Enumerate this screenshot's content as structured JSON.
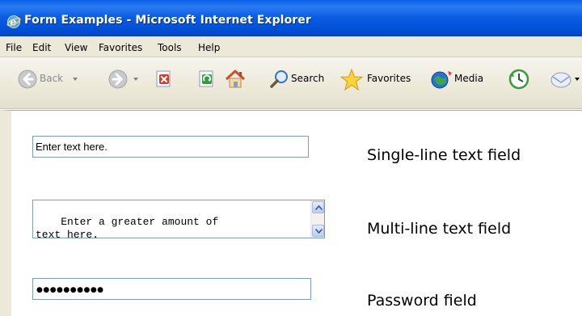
{
  "window": {
    "title": "Form Examples - Microsoft Internet Explorer",
    "app_icon": "ie-icon"
  },
  "menubar": {
    "items": [
      "File",
      "Edit",
      "View",
      "Favorites",
      "Tools",
      "Help"
    ]
  },
  "toolbar": {
    "back_label": "Back",
    "search_label": "Search",
    "favorites_label": "Favorites",
    "media_label": "Media",
    "icons": [
      "back-arrow-icon",
      "forward-arrow-icon",
      "stop-icon",
      "refresh-icon",
      "home-icon",
      "search-icon",
      "favorites-star-icon",
      "media-icon",
      "history-icon",
      "mail-icon"
    ]
  },
  "content": {
    "single_line": {
      "value": "Enter text here.",
      "label": "Single-line text field"
    },
    "multi_line": {
      "value": "Enter a greater amount of\ntext here.",
      "label": "Multi-line text field"
    },
    "password": {
      "value": "●●●●●●●●●●",
      "label": "Password field"
    }
  },
  "colors": {
    "titlebar": "#0054e3",
    "chrome": "#ece9d8",
    "field_border": "#7f9db9"
  }
}
